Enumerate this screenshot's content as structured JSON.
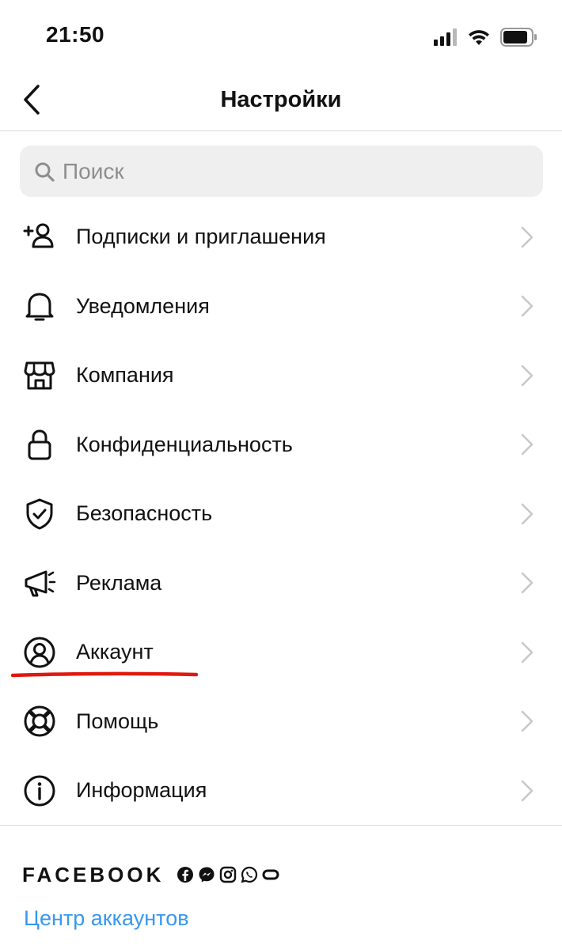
{
  "status_bar": {
    "time": "21:50",
    "icons": [
      "cellular-signal-icon",
      "wifi-icon",
      "battery-icon"
    ]
  },
  "nav": {
    "title": "Настройки",
    "back_icon": "chevron-left-icon"
  },
  "search": {
    "placeholder": "Поиск",
    "value": "",
    "icon": "search-icon"
  },
  "menu": {
    "items": [
      {
        "label": "Подписки и приглашения",
        "icon": "add-person-icon"
      },
      {
        "label": "Уведомления",
        "icon": "bell-icon"
      },
      {
        "label": "Компания",
        "icon": "storefront-icon"
      },
      {
        "label": "Конфиденциальность",
        "icon": "lock-icon"
      },
      {
        "label": "Безопасность",
        "icon": "shield-check-icon"
      },
      {
        "label": "Реклама",
        "icon": "megaphone-icon"
      },
      {
        "label": "Аккаунт",
        "icon": "account-circle-icon",
        "highlighted": true
      },
      {
        "label": "Помощь",
        "icon": "lifebuoy-icon"
      },
      {
        "label": "Информация",
        "icon": "info-icon"
      }
    ],
    "chevron_icon": "chevron-right-icon"
  },
  "annotation": {
    "underline_color": "#e0180f",
    "target": "Аккаунт"
  },
  "footer": {
    "brand": "FACEBOOK",
    "brand_icons": [
      "facebook-icon",
      "messenger-icon",
      "instagram-icon",
      "whatsapp-icon",
      "portal-icon"
    ],
    "account_center_link": "Центр аккаунтов"
  },
  "colors": {
    "link": "#3897f0",
    "search_bg": "#efefef",
    "divider": "#dbdbdb",
    "chevron": "#c7c7cc"
  }
}
